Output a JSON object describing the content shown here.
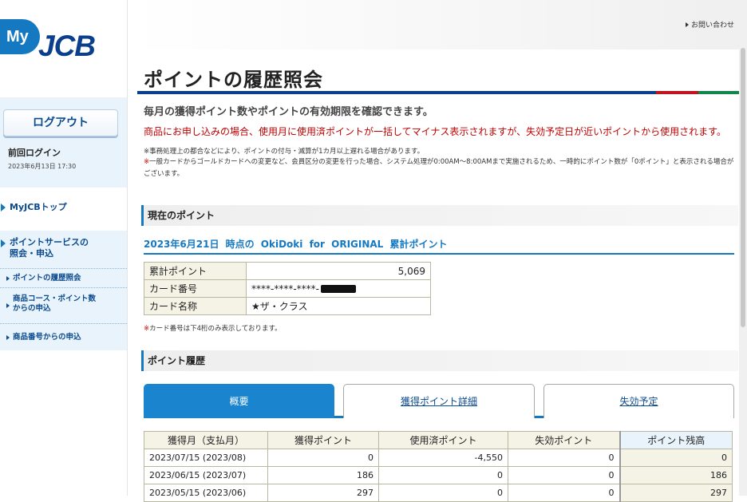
{
  "logo": {
    "my": "My",
    "brand": "JCB"
  },
  "header": {
    "contact": "お問い合わせ"
  },
  "sidebar": {
    "logout_label": "ログアウト",
    "last_login_label": "前回ログイン",
    "last_login_date": "2023年6月13日 17:30",
    "top_link": "MyJCBトップ",
    "service_heading": "ポイントサービスの照会・申込",
    "items": [
      {
        "label": "ポイントの履歴照会"
      },
      {
        "label": "商品コース・ポイント数からの申込"
      },
      {
        "label": "商品番号からの申込"
      }
    ]
  },
  "page": {
    "title": "ポイントの履歴照会",
    "description": "毎月の獲得ポイント数やポイントの有効期限を確認できます。",
    "warning": "商品にお申し込みの場合、使用月に使用済ポイントが一括してマイナス表示されますが、失効予定日が近いポイントから使用されます。",
    "note1_mark": "※",
    "note1": "事務処理上の都合などにより、ポイントの付与・減算が1カ月以上遅れる場合があります。",
    "note2_mark": "※",
    "note2": "一般カードからゴールドカードへの変更など、会員区分の変更を行った場合、システム処理が0:00AM～8:00AMまで実施されるため、一時的にポイント数が「0ポイント」と表示される場合がございます。"
  },
  "current": {
    "heading": "現在のポイント",
    "subtitle": "2023年6月21日 時点の OkiDoki for ORIGINAL 累計ポイント",
    "rows": [
      {
        "label": "累計ポイント",
        "value": "5,069"
      },
      {
        "label": "カード番号",
        "value": "****-****-****-"
      },
      {
        "label": "カード名称",
        "value": "★ザ・クラス"
      }
    ],
    "note_mark": "※",
    "note": "カード番号は下4桁のみ表示しております。"
  },
  "history": {
    "heading": "ポイント履歴",
    "tabs": [
      {
        "label": "概要",
        "active": true
      },
      {
        "label": "獲得ポイント詳細",
        "active": false
      },
      {
        "label": "失効予定",
        "active": false
      }
    ],
    "columns": [
      "獲得月（支払月）",
      "獲得ポイント",
      "使用済ポイント",
      "失効ポイント",
      "ポイント残高"
    ],
    "rows": [
      [
        "2023/07/15 (2023/08)",
        "0",
        "-4,550",
        "0",
        "0"
      ],
      [
        "2023/06/15 (2023/07)",
        "186",
        "0",
        "0",
        "186"
      ],
      [
        "2023/05/15 (2023/06)",
        "297",
        "0",
        "0",
        "297"
      ]
    ]
  },
  "colors": {
    "brand_blue": "#1579c2",
    "navy": "#0b3f8c",
    "warning_red": "#c00000",
    "accent_green": "#12864a"
  }
}
